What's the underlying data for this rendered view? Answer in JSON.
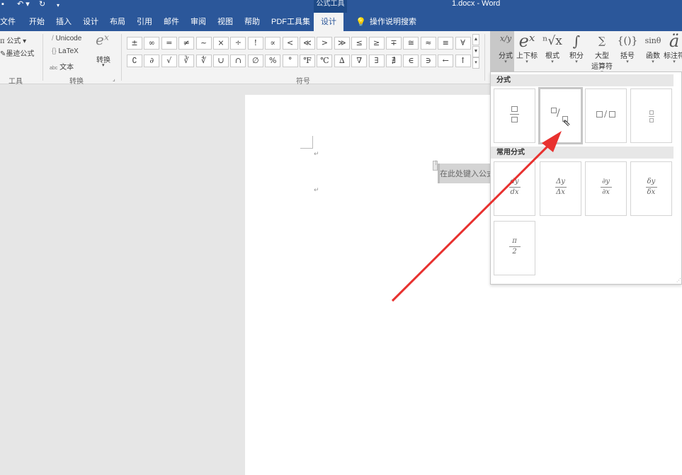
{
  "titlebar": {
    "context_tab": "公式工具",
    "doc_title": "1.docx  -  Word"
  },
  "tabs": [
    "文件",
    "开始",
    "插入",
    "设计",
    "布局",
    "引用",
    "邮件",
    "审阅",
    "视图",
    "帮助",
    "PDF工具集",
    "设计"
  ],
  "tell_me": "操作说明搜索",
  "tools_group": {
    "equation": "公式",
    "ink": "墨迹公式",
    "label": "工具"
  },
  "convert_group": {
    "unicode": "Unicode",
    "latex": "LaTeX",
    "text": "文本",
    "convert": "转换",
    "label": "转换"
  },
  "symbols_group": {
    "label": "符号",
    "row1": [
      "±",
      "∞",
      "=",
      "≠",
      "~",
      "×",
      "÷",
      "!",
      "∝",
      "<",
      "≪",
      ">",
      "≫",
      "≤",
      "≥",
      "∓",
      "≅",
      "≈",
      "≡",
      "∀"
    ],
    "row2": [
      "∁",
      "∂",
      "√",
      "∛",
      "∜",
      "∪",
      "∩",
      "∅",
      "%",
      "°",
      "℉",
      "℃",
      "∆",
      "∇",
      "∃",
      "∄",
      "∈",
      "∋",
      "←",
      "↑"
    ]
  },
  "structures": [
    {
      "glyph": "x/y",
      "label": "分式"
    },
    {
      "glyph": "eˣ",
      "label": "上下标"
    },
    {
      "glyph": "ⁿ√x",
      "label": "根式"
    },
    {
      "glyph": "∫",
      "label": "积分"
    },
    {
      "glyph": "∑",
      "label": "大型",
      "label2": "运算符"
    },
    {
      "glyph": "{()}",
      "label": "括号"
    },
    {
      "glyph": "sinθ",
      "label": "函数"
    },
    {
      "glyph": "ä",
      "label": "标注符"
    }
  ],
  "gallery": {
    "section1": "分式",
    "section2": "常用分式",
    "common": [
      {
        "num": "dy",
        "den": "dx"
      },
      {
        "num": "Δy",
        "den": "Δx"
      },
      {
        "num": "∂y",
        "den": "∂x"
      },
      {
        "num": "δy",
        "den": "δx"
      },
      {
        "num": "π",
        "den": "2"
      }
    ]
  },
  "document": {
    "placeholder": "在此处键入公式",
    "mark": "↵"
  },
  "colors": {
    "ribbon_blue": "#2b579a",
    "arrow": "#e8312f"
  }
}
